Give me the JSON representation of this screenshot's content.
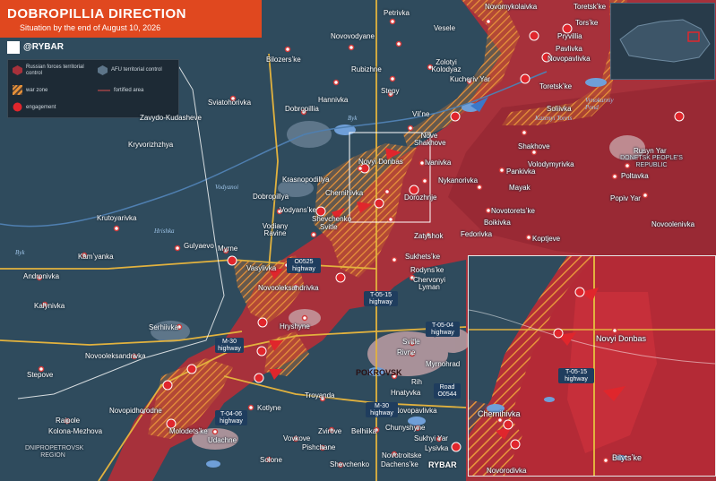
{
  "header": {
    "title": "DOBROPILLIA DIRECTION",
    "subtitle": "Situation by the end of August 10, 2026",
    "brand": "@RYBAR"
  },
  "legend": {
    "russian": "Russian forces territorial control",
    "afu": "AFU territorial control",
    "war_zone": "war zone",
    "fortified": "fortified area",
    "engagement": "engagement"
  },
  "colors": {
    "russian": "#a7313b",
    "afu": "#2f4b5d",
    "war_zone": "#e08a34",
    "header": "#e0481f",
    "water": "#6f9fd8"
  },
  "icons": [
    "qr-code-icon",
    "telegram-icon",
    "engagement-icon",
    "arrow-icon",
    "settlement-icon"
  ],
  "places": {
    "petrivka": "Petrivka",
    "novomykolaivka": "Novomykolaivka",
    "toretske_top": "Toretskʼke",
    "torske": "Torsʼke",
    "pryvilla": "Pryvillia",
    "pavlivka": "Pavlivka",
    "novopavlivka_n": "Novopavlivka",
    "veselle": "Veselе",
    "novovodyane": "Novovodyane",
    "bilozerske": "Bilozersʼke",
    "zoloty_kolodyaz": "Zolotyi Kolodyaz",
    "rubizhne": "Rubizhne",
    "kucheriv_yar": "Kucheriv Yar",
    "toretske_mid": "Toretskʼke",
    "stepy": "Stepy",
    "hannivka": "Hannivka",
    "sviatohorivka": "Sviatohorivka",
    "dobropillia": "Dobropillia",
    "vilne": "Vilʼne",
    "soliivka": "Soliivka",
    "kazenyi_torets": "Kazenyi Torets",
    "vynokurniy_pond": "Vynokurniy Pond",
    "zavydo": "Zavydo-Kudasheve",
    "nove_shakhove": "Nove Shakhove",
    "shakhove": "Shakhove",
    "kryvorizhzhya": "Kryvorizhzhya",
    "novyi_donbas": "Novyi Donbas",
    "ivanivka": "Ivanivka",
    "volodymyrivka": "Volodymyrivka",
    "dpr": "DONETSK PEOPLE'S REPUBLIC",
    "rusyn_yar": "Rusyn Yar",
    "krasnopodillya": "Krasnopodillya",
    "pankivka": "Pankivka",
    "poltavka": "Poltavka",
    "chernihivka": "Chernihivka",
    "nykanorivka": "Nykanorivka",
    "dobropillya_w": "Dobropillya",
    "dorozhnje": "Dorozhnje",
    "mayak": "Mayak",
    "popiv_yar": "Popiv Yar",
    "vodyanske": "Vodyansʼke",
    "bilyts_ke": "Bilytsʼke",
    "novotoretske": "Novotoretsʼke",
    "novoolenivka": "Novoolenivka",
    "krutoyarivka": "Krutoyarivka",
    "vodiany_ravine": "Vodiany Ravine",
    "shevchenko_n": "Shevchenko",
    "svitle_n": "Svitle",
    "zatyshok": "Zatyshok",
    "boikivka": "Boikivka",
    "fedorivka": "Fedorivka",
    "koptjeve": "Koptjeve",
    "gulyaevo": "Gulyaevo",
    "myrne": "Myrne",
    "kamyanka": "Kamʼyanka",
    "sukhetske": "Sukhetsʼke",
    "andronivka": "Andronivka",
    "vasylivka": "Vasylivka",
    "novooleksandrivka_c": "Novooleksandrivka",
    "rodynske": "Rodynsʼke",
    "chervonyi_lyman": "Chervonyi Lyman",
    "kalynivka": "Kalynivka",
    "hryshyne": "Hryshyne",
    "serhiivka": "Serhiivka",
    "novooleksandrivka_w": "Novooleksandrivka",
    "svitle_s": "Svitle",
    "rivne": "Rivne",
    "myrnohrad": "Myrnohrad",
    "stepove": "Stepove",
    "pokrovsk": "POKROVSK",
    "rih": "Rih",
    "hnatyvka": "Hnatyvka",
    "troyanda": "Troyanda",
    "novopidhorodne": "Novopidhorodne",
    "kotlyne": "Kotlyne",
    "novopavlivka_s": "Novopavlivka",
    "raipole": "Raipole",
    "kolona_mezhova": "Kolona-Mezhova",
    "molodetske": "Molodetsʼke",
    "udachne": "Udachne",
    "zvirove": "Zvirove",
    "belhiika": "Belhiika",
    "chunyshyne": "Chunyshyne",
    "sukhyi_yar": "Sukhyi Yar",
    "vovkove": "Vovkove",
    "pishchane": "Pishchane",
    "lysivka": "Lysivka",
    "dnipropetrovsk": "DNIPROPETROVSK REGION",
    "solone": "Solone",
    "shevchenko_s": "Shevchenko",
    "novotroitske": "Novotroitske",
    "dachens_ke": "Dachensʼke",
    "rybar_footer": "RYBAR"
  },
  "rivers": {
    "byk_main": "Byk",
    "byk_w": "Byk",
    "vodyanoi": "Vodyanoi",
    "hrishyka": "Hrishka",
    "kazenyi": "Kazenyi Torets"
  },
  "roads": {
    "o0525": "O0525 highway",
    "t0515": "T-05-15 highway",
    "t0504": "T-05-04 highway",
    "m30_w": "M-30 highway",
    "m30_s": "M-30 highway",
    "road_o0544": "Road O0544",
    "t0406": "T-04-06 highway"
  },
  "zoom": {
    "novyi_donbas": "Novyi Donbas",
    "chernihivka": "Chernihivka",
    "bilytske": "Bilytsʼke",
    "novorodivka": "Novorodivka",
    "t0515": "T-05-15 highway"
  }
}
